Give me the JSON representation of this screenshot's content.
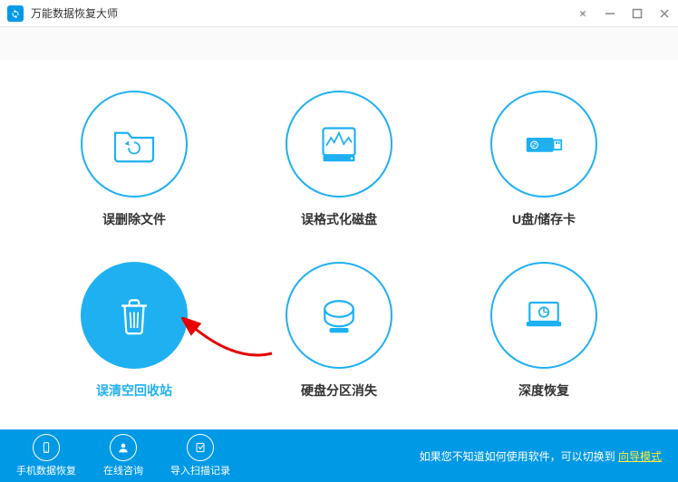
{
  "app": {
    "title": "万能数据恢复大师"
  },
  "options": [
    {
      "label": "误删除文件"
    },
    {
      "label": "误格式化磁盘"
    },
    {
      "label": "U盘/储存卡"
    },
    {
      "label": "误清空回收站"
    },
    {
      "label": "硬盘分区消失"
    },
    {
      "label": "深度恢复"
    }
  ],
  "footer": {
    "items": [
      {
        "label": "手机数据恢复"
      },
      {
        "label": "在线咨询"
      },
      {
        "label": "导入扫描记录"
      }
    ],
    "hint_prefix": "如果您不知道如何使用软件，可以切换到 ",
    "hint_link": "向导模式"
  },
  "colors": {
    "primary": "#1fb0f2",
    "footer": "#0099e6"
  }
}
